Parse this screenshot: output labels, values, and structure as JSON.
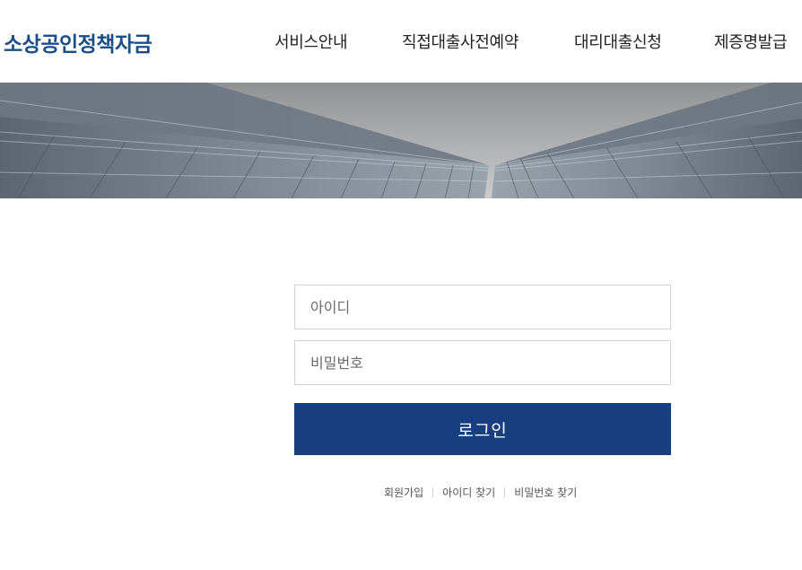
{
  "header": {
    "logo": "소상공인정책자금",
    "nav": [
      {
        "label": "서비스안내"
      },
      {
        "label": "직접대출사전예약"
      },
      {
        "label": "대리대출신청"
      },
      {
        "label": "제증명발급"
      }
    ]
  },
  "login": {
    "id_placeholder": "아이디",
    "pw_placeholder": "비밀번호",
    "submit_label": "로그인"
  },
  "links": {
    "signup": "회원가입",
    "find_id": "아이디 찾기",
    "find_pw": "비밀번호 찾기"
  },
  "colors": {
    "brand": "#1b4e86",
    "button": "#173f80"
  }
}
